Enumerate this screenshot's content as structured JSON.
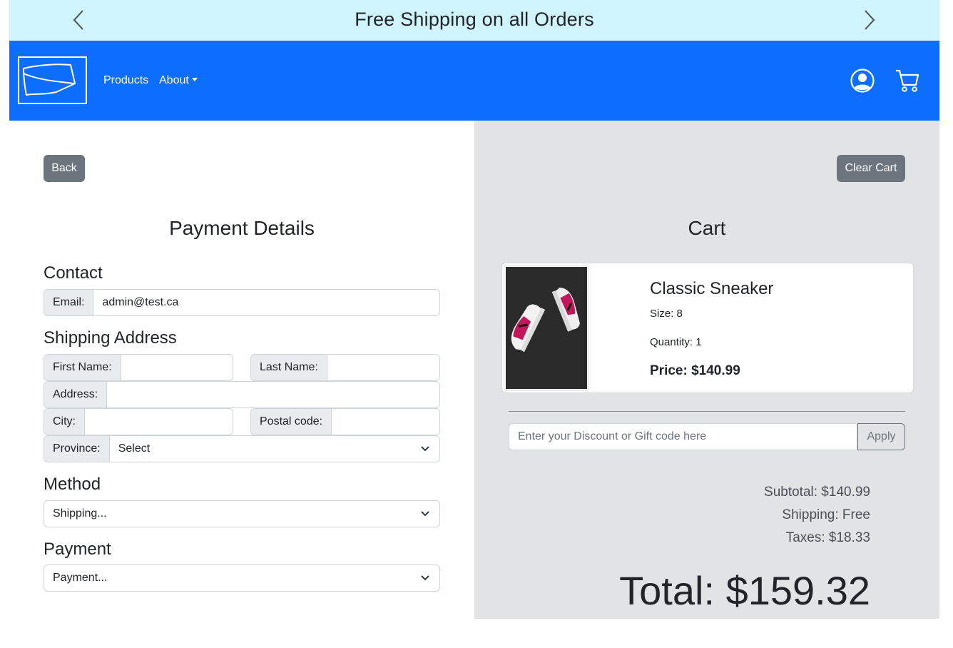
{
  "announcement": {
    "message": "Free Shipping on all Orders",
    "prev_icon": "chevron-left-icon",
    "next_icon": "chevron-right-icon"
  },
  "navbar": {
    "bg_color": "#0d6efd",
    "logo_icon": "brand-logo",
    "links": {
      "products": "Products",
      "about": "About"
    },
    "account_icon": "user-circle-icon",
    "cart_icon": "cart-icon"
  },
  "payment": {
    "back_label": "Back",
    "title": "Payment Details",
    "contact": {
      "heading": "Contact",
      "email_label": "Email:",
      "email_value": "admin@test.ca"
    },
    "shipping_address": {
      "heading": "Shipping Address",
      "first_name_label": "First Name:",
      "first_name_value": "",
      "last_name_label": "Last Name:",
      "last_name_value": "",
      "address_label": "Address:",
      "address_value": "",
      "city_label": "City:",
      "city_value": "",
      "postal_label": "Postal code:",
      "postal_value": "",
      "province_label": "Province:",
      "province_value": "Select"
    },
    "method": {
      "heading": "Method",
      "value": "Shipping..."
    },
    "payment_method": {
      "heading": "Payment",
      "value": "Payment..."
    }
  },
  "cart": {
    "clear_label": "Clear Cart",
    "title": "Cart",
    "items": [
      {
        "name": "Classic Sneaker",
        "size": "Size: 8",
        "quantity": "Quantity: 1",
        "price": "Price: $140.99"
      }
    ],
    "discount_placeholder": "Enter your Discount or Gift code here",
    "apply_label": "Apply",
    "subtotal": "Subtotal: $140.99",
    "shipping": "Shipping: Free",
    "taxes": "Taxes: $18.33",
    "total": "Total: $159.32"
  }
}
